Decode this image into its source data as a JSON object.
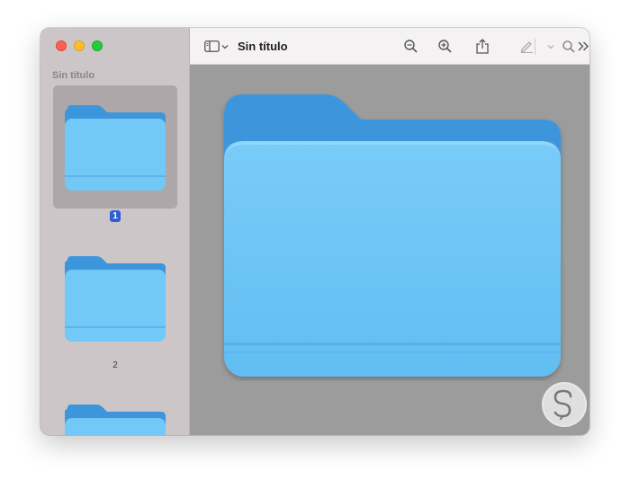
{
  "window": {
    "title": "Sin título"
  },
  "sidebar": {
    "title": "Sin título",
    "pages": [
      {
        "label": "1",
        "selected": true
      },
      {
        "label": "2",
        "selected": false
      },
      {
        "label": "",
        "selected": false
      }
    ]
  },
  "toolbar": {
    "icons": [
      "sidebar-toggle-icon",
      "chevron-down-icon",
      "zoom-out-icon",
      "zoom-in-icon",
      "share-icon",
      "markup-icon",
      "chevron-down-icon",
      "more-tools-icon",
      "search-icon"
    ]
  },
  "colors": {
    "folder_front": "#72c8f7",
    "folder_back": "#3d96dc",
    "selection": "#2f5ed7"
  },
  "watermark": {
    "name": "solvetic-logo"
  }
}
